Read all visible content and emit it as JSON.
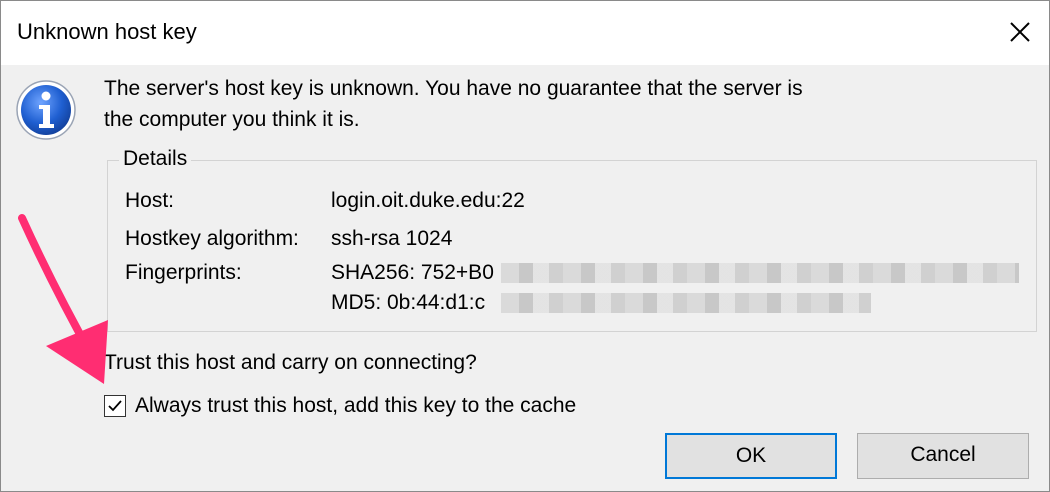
{
  "window": {
    "title": "Unknown host key",
    "close_glyph": "✕"
  },
  "message": {
    "line1": "The server's host key is unknown. You have no guarantee that the server is",
    "line2": "the computer you think it is."
  },
  "details": {
    "legend": "Details",
    "host_label": "Host:",
    "host_value": "login.oit.duke.edu:22",
    "algo_label": "Hostkey algorithm:",
    "algo_value": "ssh-rsa 1024",
    "fp_label": "Fingerprints:",
    "fp_sha256": "SHA256: 752+B0",
    "fp_md5": "MD5: 0b:44:d1:c"
  },
  "prompt": {
    "question": "Trust this host and carry on connecting?"
  },
  "checkbox": {
    "label": "Always trust this host, add this key to the cache",
    "checked": true
  },
  "buttons": {
    "ok": "OK",
    "cancel": "Cancel"
  },
  "icons": [
    "info-icon",
    "close-icon",
    "checkmark-icon",
    "annotation-arrow"
  ],
  "colors": {
    "accent": "#0078d7",
    "arrow": "#ff2d72",
    "info_blue": "#1f5fd1"
  }
}
